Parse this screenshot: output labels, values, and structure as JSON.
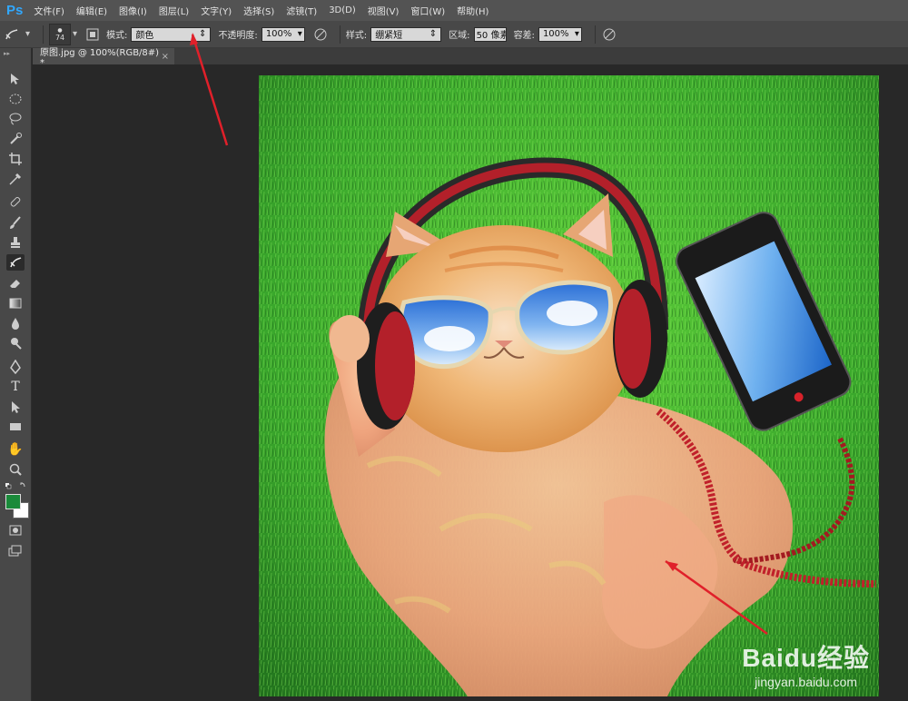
{
  "app": {
    "logo": "Ps"
  },
  "menu": [
    "文件(F)",
    "编辑(E)",
    "图像(I)",
    "图层(L)",
    "文字(Y)",
    "选择(S)",
    "滤镜(T)",
    "3D(D)",
    "视图(V)",
    "窗口(W)",
    "帮助(H)"
  ],
  "options": {
    "brush_size": "74",
    "mode_label": "模式:",
    "mode_value": "颜色",
    "opacity_label": "不透明度:",
    "opacity_value": "100%",
    "style_label": "样式:",
    "style_value": "绷紧短",
    "area_label": "区域:",
    "area_value": "50 像素",
    "tolerance_label": "容差:",
    "tolerance_value": "100%"
  },
  "document": {
    "tab_title": "原图.jpg @ 100%(RGB/8#) *",
    "tab_close": "×"
  },
  "colors": {
    "foreground": "#1a8a3a",
    "background": "#ffffff",
    "arrow": "#e0202a"
  },
  "watermark": {
    "brand": "Baidu经验",
    "url": "jingyan.baidu.com"
  }
}
